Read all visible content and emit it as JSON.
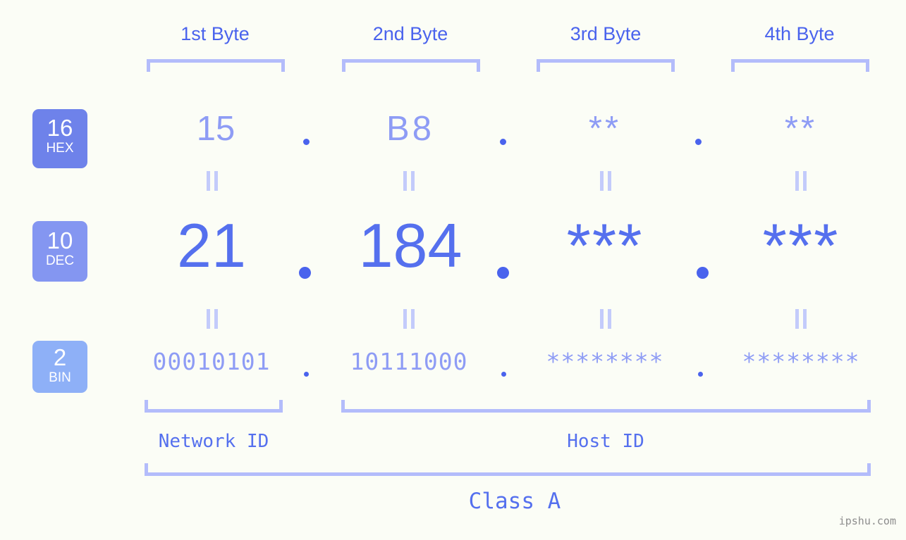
{
  "background_color": "#fbfdf6",
  "accent_colors": {
    "strong_blue": "#4a63ed",
    "mid_blue": "#5570ee",
    "light_periwinkle": "#8e9cf5",
    "bracket_blue": "#b3bcfb",
    "badge_hex": "#6e82ea",
    "badge_dec": "#8496f1",
    "badge_bin": "#8eb0f7",
    "watermark_gray": "#8d8d8d"
  },
  "byte_headers": [
    {
      "label": "1st Byte"
    },
    {
      "label": "2nd Byte"
    },
    {
      "label": "3rd Byte"
    },
    {
      "label": "4th Byte"
    }
  ],
  "bases": [
    {
      "number": "16",
      "name": "HEX"
    },
    {
      "number": "10",
      "name": "DEC"
    },
    {
      "number": "2",
      "name": "BIN"
    }
  ],
  "rows": {
    "hex": {
      "values": [
        "15",
        "B8",
        "**",
        "**"
      ]
    },
    "dec": {
      "values": [
        "21",
        "184",
        "***",
        "***"
      ]
    },
    "bin": {
      "values": [
        "00010101",
        "10111000",
        "********",
        "********"
      ]
    }
  },
  "separator": ".",
  "equals_marker": "=",
  "segments": {
    "network_id": "Network ID",
    "host_id": "Host ID"
  },
  "class_label": "Class A",
  "watermark": "ipshu.com"
}
